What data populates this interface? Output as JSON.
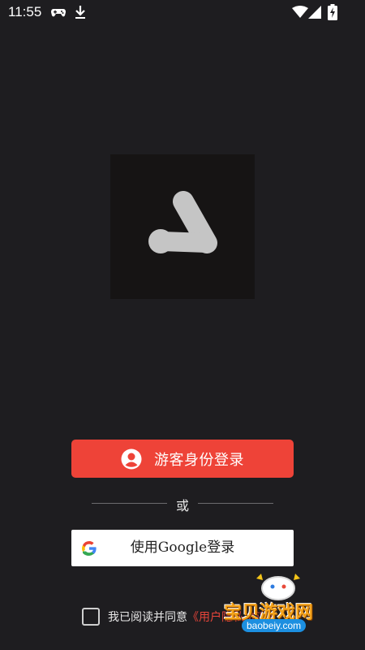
{
  "status_bar": {
    "time": "11:55",
    "icons": [
      "gamepad-icon",
      "download-icon",
      "wifi-icon",
      "signal-icon",
      "battery-charging-icon"
    ]
  },
  "logo": {
    "icon": "app-logo-icon",
    "background": "#161414"
  },
  "login": {
    "guest_button_label": "游客身份登录",
    "divider_text": "或",
    "google_button_label": "使用Google登录",
    "agreement_text": "我已阅读并同意",
    "agreement_link": "《用户隐私协议》"
  },
  "watermark": {
    "title": "宝贝游戏网",
    "url": "baobeiy.com"
  },
  "colors": {
    "background": "#1e1d20",
    "primary": "#ee4338",
    "link": "#e8453a"
  }
}
